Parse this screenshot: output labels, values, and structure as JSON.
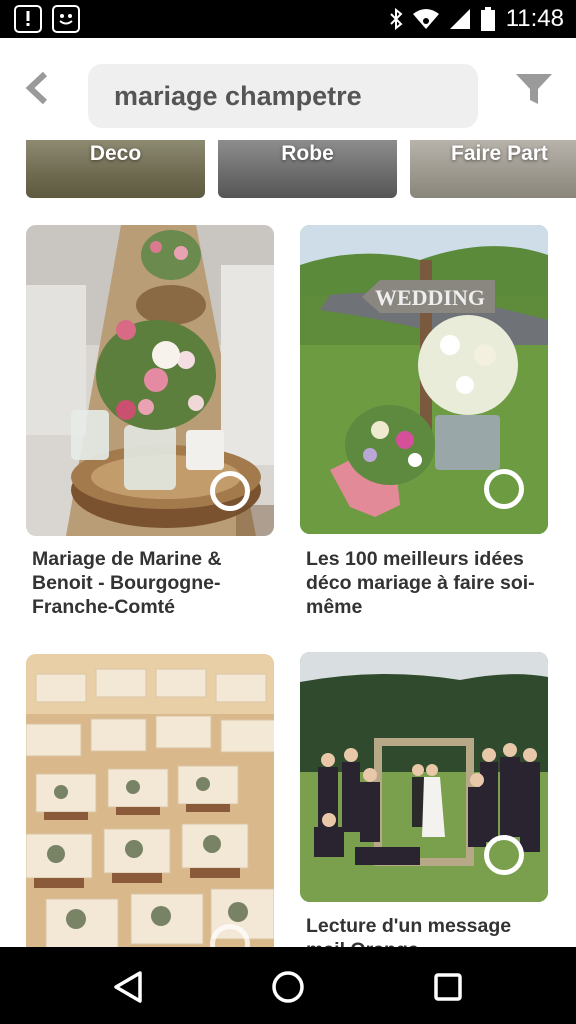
{
  "status_bar": {
    "time": "11:48",
    "icons": [
      "notification-alert-icon",
      "notification-smiley-icon",
      "bluetooth-icon",
      "wifi-icon",
      "signal-icon",
      "battery-icon"
    ]
  },
  "header": {
    "search_value": "mariage champetre",
    "back_icon": "back-chevron-icon",
    "filter_icon": "filter-icon"
  },
  "chips": [
    {
      "label": "Deco"
    },
    {
      "label": "Robe"
    },
    {
      "label": "Faire Part"
    }
  ],
  "pins": [
    {
      "title": "Mariage de Marine & Benoit - Bourgogne-Franche-Comté"
    },
    {
      "title": "Les 100 meilleurs idées déco mariage à faire soi-même",
      "image_text": "WEDDING"
    },
    {
      "title": ""
    },
    {
      "title": "Lecture d'un message mail Orange"
    }
  ],
  "nav_bar": {
    "icons": [
      "nav-back-icon",
      "nav-home-icon",
      "nav-recents-icon"
    ]
  }
}
